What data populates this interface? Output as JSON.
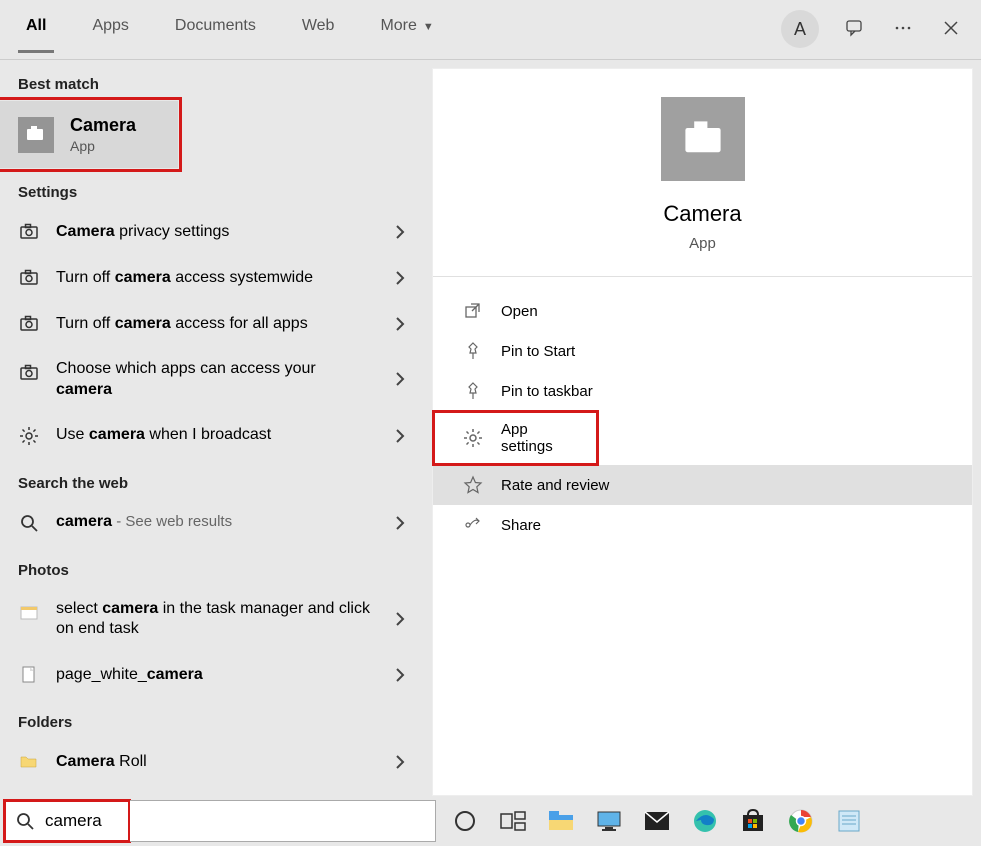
{
  "tabs": {
    "all": "All",
    "apps": "Apps",
    "documents": "Documents",
    "web": "Web",
    "more": "More"
  },
  "top_right": {
    "avatar_letter": "A"
  },
  "sections": {
    "best_match": "Best match",
    "settings": "Settings",
    "search_web": "Search the web",
    "photos": "Photos",
    "folders": "Folders"
  },
  "best_match": {
    "title": "Camera",
    "subtitle": "App"
  },
  "settings_rows": [
    {
      "prefix": "",
      "bold": "Camera",
      "suffix": " privacy settings"
    },
    {
      "prefix": "Turn off ",
      "bold": "camera",
      "suffix": " access systemwide"
    },
    {
      "prefix": "Turn off ",
      "bold": "camera",
      "suffix": " access for all apps"
    },
    {
      "prefix": "Choose which apps can access your ",
      "bold": "camera",
      "suffix": ""
    },
    {
      "prefix": "Use ",
      "bold": "camera",
      "suffix": " when I broadcast"
    }
  ],
  "web_row": {
    "bold": "camera",
    "suffix": " - See web results"
  },
  "photos_rows": [
    {
      "prefix": "select ",
      "bold": "camera",
      "suffix": " in the task manager and click on end task"
    },
    {
      "prefix": "page_white_",
      "bold": "camera",
      "suffix": ""
    }
  ],
  "folder_row": {
    "bold": "Camera",
    "suffix": " Roll"
  },
  "detail": {
    "title": "Camera",
    "subtitle": "App"
  },
  "actions": {
    "open": "Open",
    "pin_start": "Pin to Start",
    "pin_taskbar": "Pin to taskbar",
    "app_settings": "App settings",
    "rate": "Rate and review",
    "share": "Share"
  },
  "search_value": "camera"
}
